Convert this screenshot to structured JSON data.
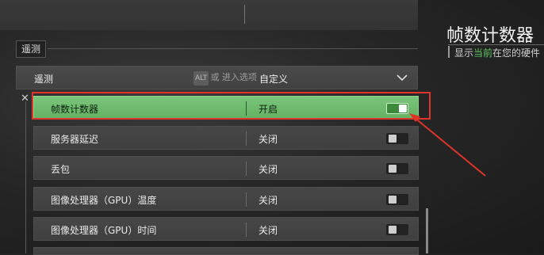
{
  "section": {
    "label": "遥测"
  },
  "dropdown": {
    "label": "遥测",
    "value": "自定义",
    "hint_key": "ALT",
    "hint_text": "或 进入选项"
  },
  "rows": [
    {
      "name": "帧数计数器",
      "value": "开启",
      "state": "on"
    },
    {
      "name": "服务器延迟",
      "value": "关闭",
      "state": "off"
    },
    {
      "name": "丢包",
      "value": "关闭",
      "state": "off"
    },
    {
      "name": "图像处理器（GPU）温度",
      "value": "关闭",
      "state": "off"
    },
    {
      "name": "图像处理器（GPU）时间",
      "value": "关闭",
      "state": "off"
    }
  ],
  "right_panel": {
    "title": "帧数计数器",
    "desc_prefix": "显示",
    "desc_highlight": "当前",
    "desc_suffix": "在您的硬件"
  },
  "colors": {
    "accent_green": "#6cbb6c",
    "highlight_red": "#e0342a"
  }
}
